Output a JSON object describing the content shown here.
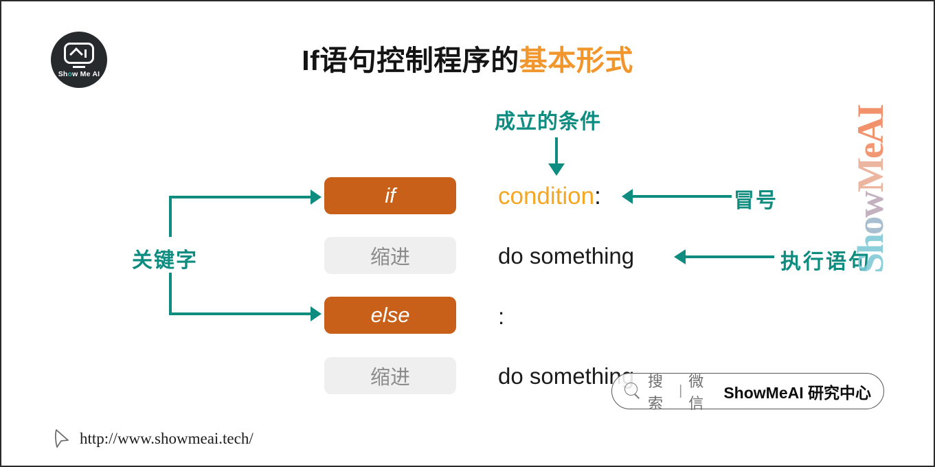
{
  "slide": {
    "title_main": "If语句控制程序的",
    "title_accent": "基本形式",
    "accent_color": "#f0962c",
    "teal_color": "#0e8c80",
    "orange_box_color": "#c8601a",
    "grey_box_color": "#efefef"
  },
  "logo": {
    "name": "show-me-ai-logo",
    "text_before": "Sh",
    "text_o": "o",
    "text_after": "w Me AI"
  },
  "annotations": {
    "condition_note": "成立的条件",
    "keyword_label": "关键字",
    "colon_label": "冒号",
    "exec_label": "执行语句"
  },
  "code": {
    "rows": [
      {
        "box": "if",
        "box_type": "keyword",
        "text": "condition",
        "punct": ":"
      },
      {
        "box": "缩进",
        "box_type": "indent",
        "text": "do something",
        "punct": ""
      },
      {
        "box": "else",
        "box_type": "keyword",
        "text": "",
        "punct": ":"
      },
      {
        "box": "缩进",
        "box_type": "indent",
        "text": "do something",
        "punct": ""
      }
    ]
  },
  "watermark": {
    "text": "ShowMeAI",
    "letters": [
      "S",
      "h",
      "o",
      "w",
      "M",
      "e",
      "A",
      "I"
    ]
  },
  "searchbar": {
    "search_label": "搜索",
    "divider": "|",
    "platform": "微信",
    "account": "ShowMeAI 研究中心"
  },
  "footer": {
    "url": "http://www.showmeai.tech/"
  }
}
